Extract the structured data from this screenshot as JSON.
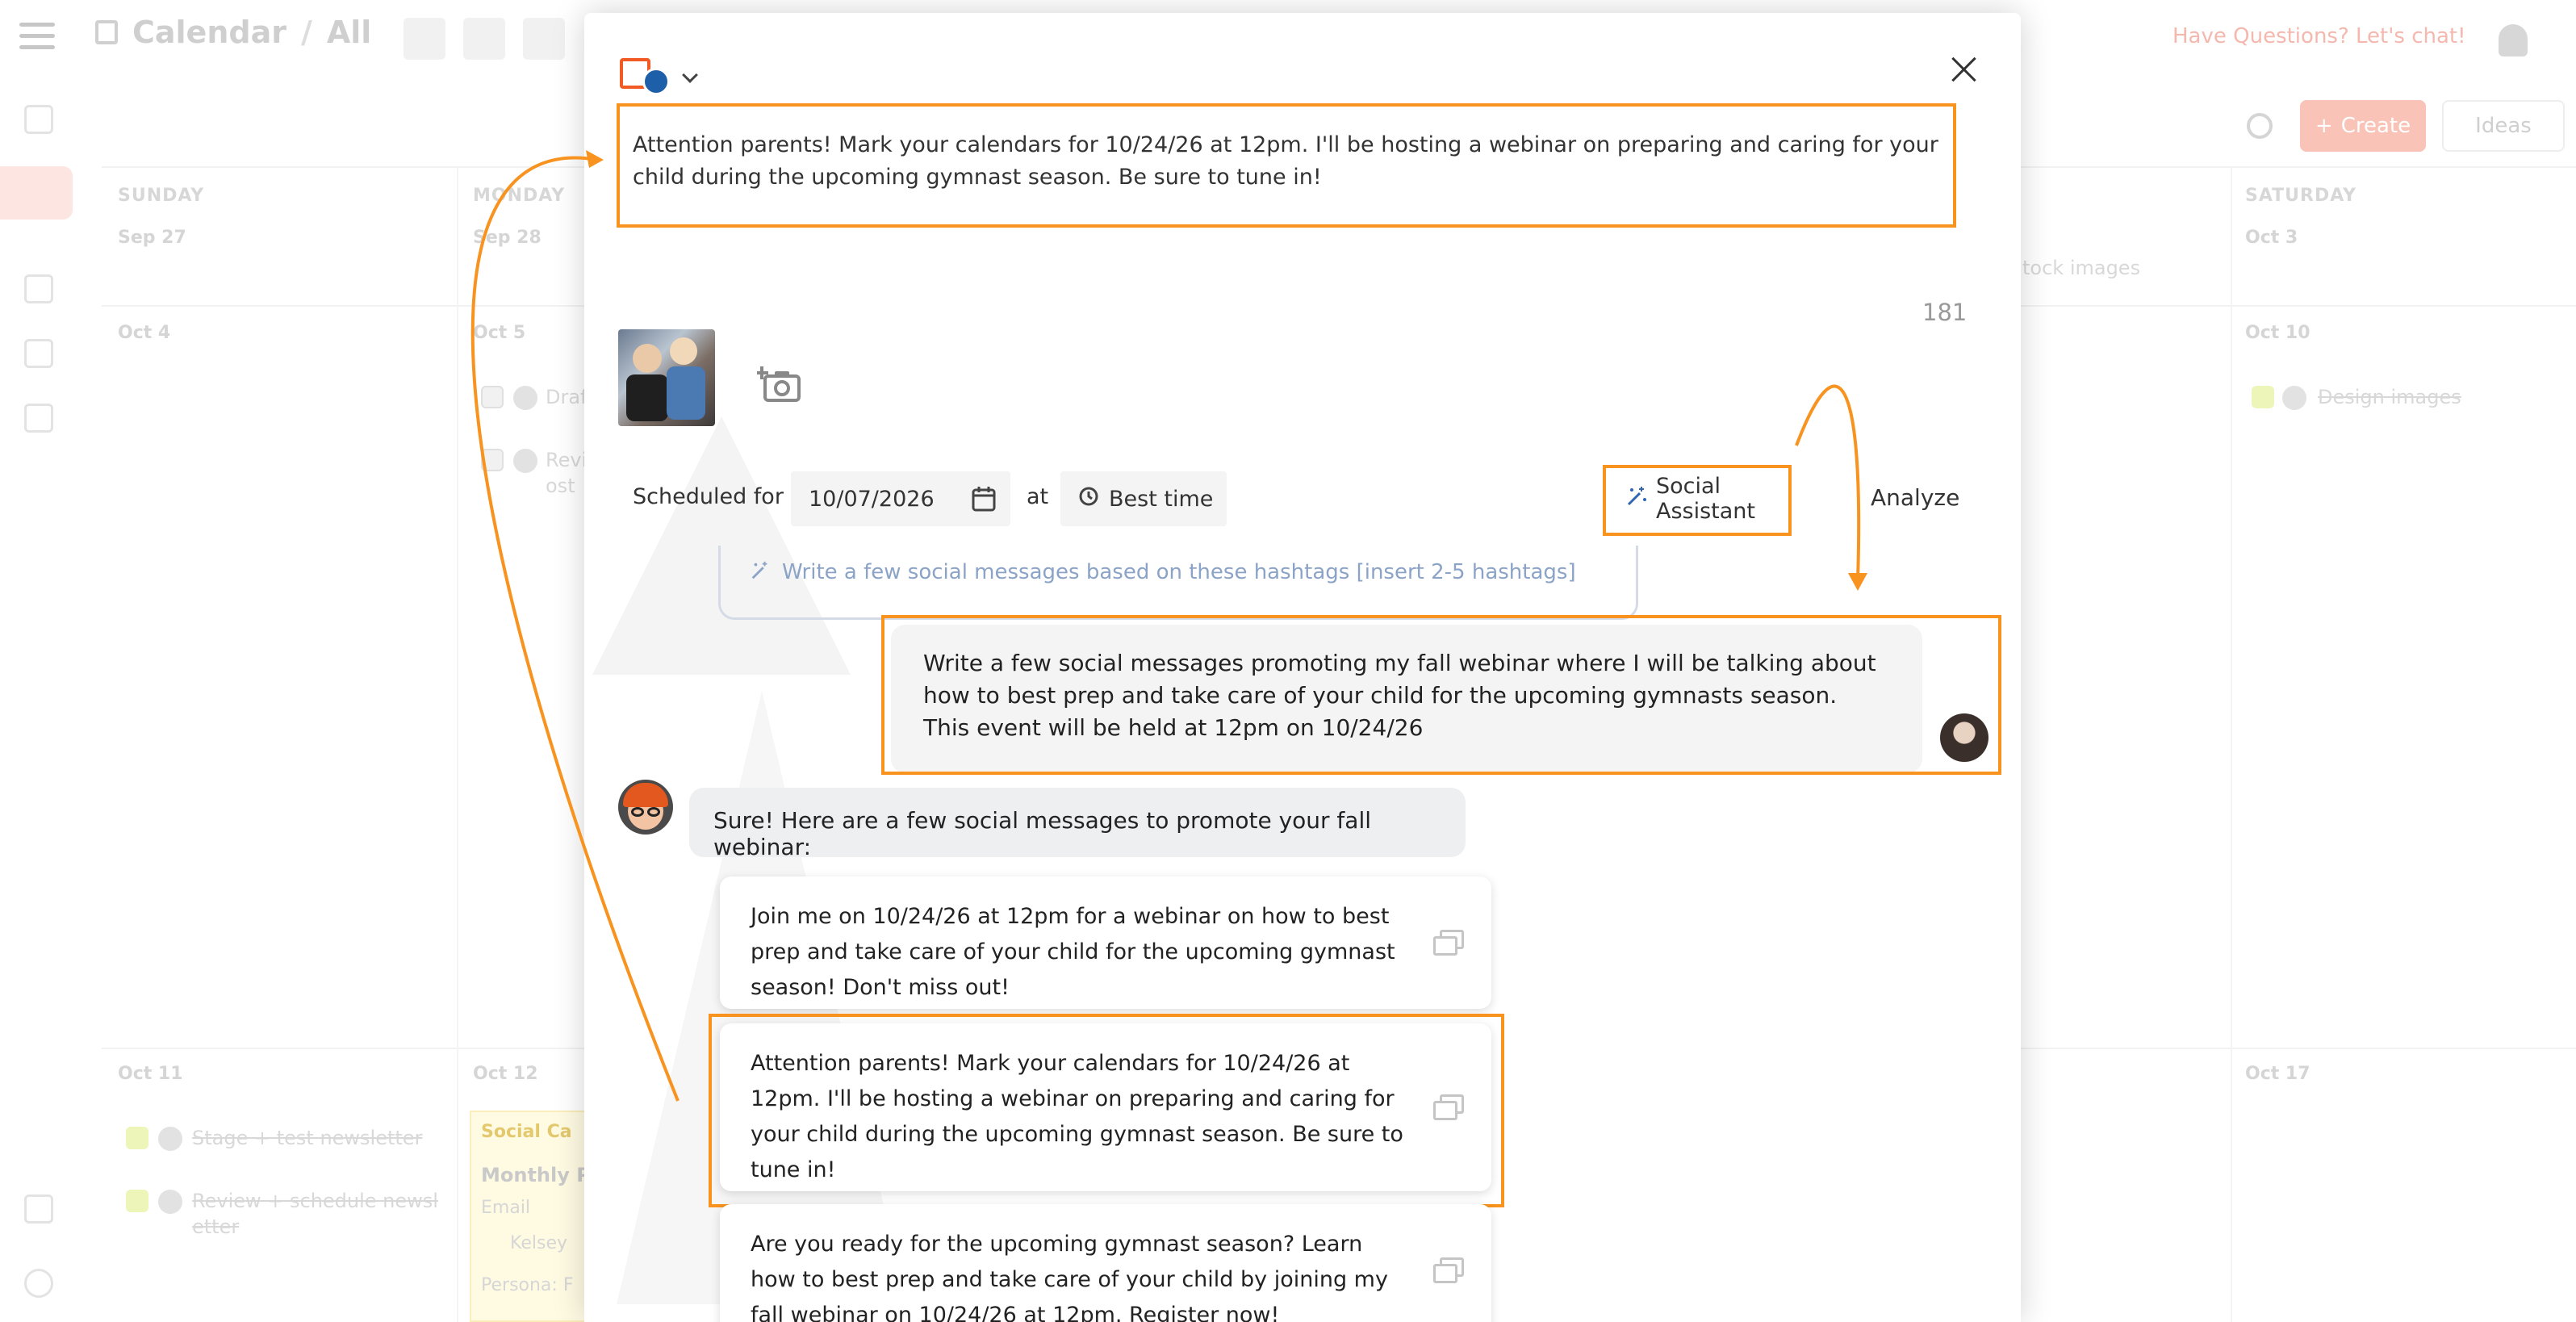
{
  "app": {
    "title": "Calendar",
    "filter": "All",
    "help": "Have Questions? Let's chat!",
    "create_label": "Create",
    "ideas_label": "Ideas"
  },
  "calendar": {
    "day_headers": [
      "SUNDAY",
      "MONDAY",
      "SATURDAY"
    ],
    "day_numbers": [
      "Sep 27",
      "Sep 28",
      "Oct 3",
      "Oct 4",
      "Oct 5",
      "Oct 10",
      "Oct 11",
      "Oct 12",
      "Oct 17"
    ],
    "ghost_items": [
      "Draf",
      "Revi",
      "ost",
      "tock images",
      "Design images",
      "Stage + test newsletter",
      "Review + schedule newsl",
      "etter",
      "Social Ca",
      "Monthly P",
      "Email",
      "Kelsey",
      "Persona: F"
    ]
  },
  "composer": {
    "post_text": "Attention parents! Mark your calendars for 10/24/26 at 12pm. I'll be hosting a webinar on preparing and caring for your child during the upcoming gymnast season. Be sure to tune in!",
    "char_count": "181",
    "scheduled_label": "Scheduled for",
    "date_value": "10/07/2026",
    "at_label": "at",
    "time_label": "Best time",
    "assistant_label": "Social Assistant",
    "analyze_label": "Analyze"
  },
  "assistant": {
    "prompt_suggestion": "Write a few social messages based on these hashtags [insert 2-5 hashtags]",
    "user_message": "Write a few social messages promoting my fall webinar where I will be talking about how to best prep and take care of your child for the upcoming gymnasts season. This event will be held at 12pm on 10/24/26",
    "bot_reply": "Sure! Here are a few social messages to promote your fall webinar:",
    "suggestions": [
      "Join me on 10/24/26 at 12pm for a webinar on how to best prep and take care of your child for the upcoming gymnast season! Don't miss out!",
      "Attention parents! Mark your calendars for 10/24/26 at 12pm. I'll be hosting a webinar on preparing and caring for your child during the upcoming gymnast season. Be sure to tune in!",
      "Are you ready for the upcoming gymnast season? Learn how to best prep and take care of your child by joining my fall webinar on 10/24/26 at 12pm. Register now!"
    ]
  },
  "colors": {
    "highlight": "#f7931e",
    "brand": "#f15a24",
    "muted_text": "#999999",
    "prompt_text": "#8ba3c7"
  }
}
